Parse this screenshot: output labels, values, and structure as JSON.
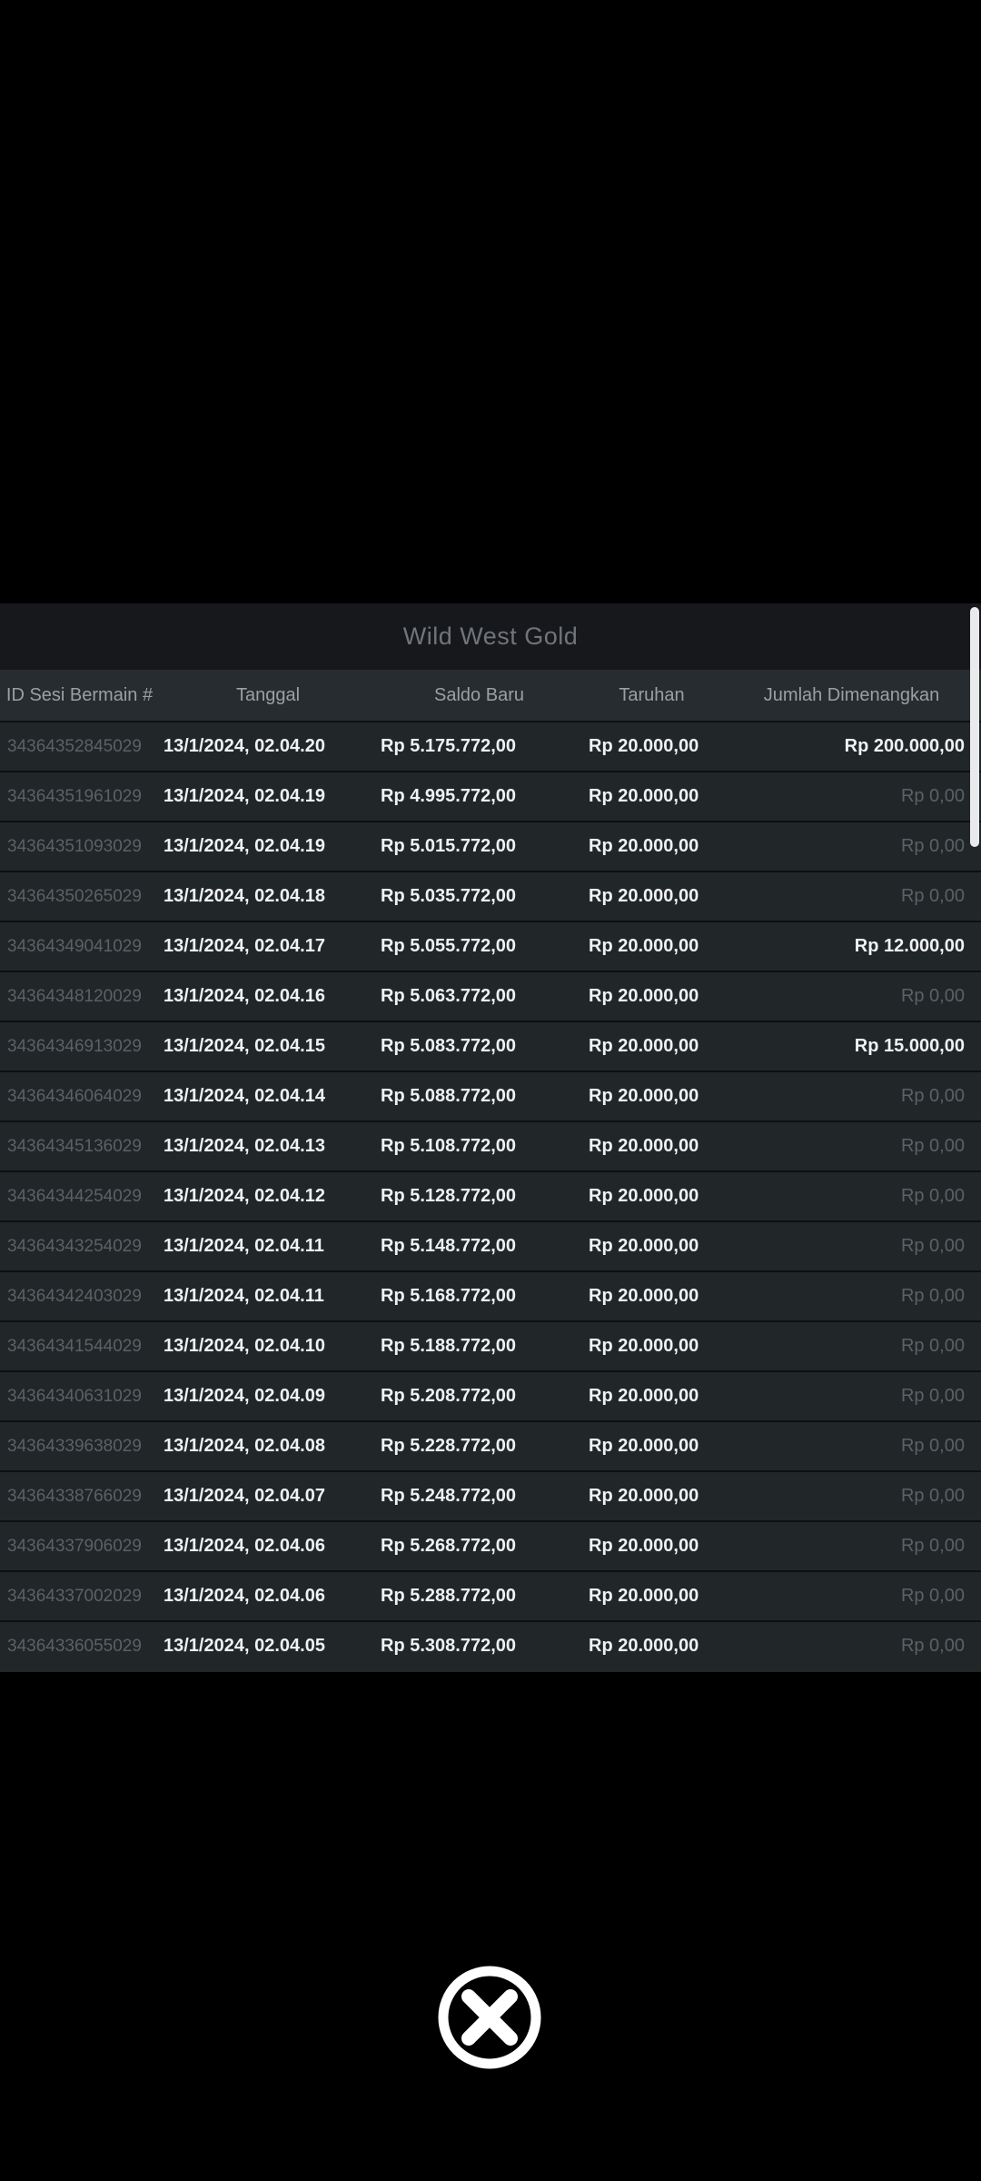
{
  "modal": {
    "title": "Wild West Gold",
    "columns": [
      "ID Sesi Bermain #",
      "Tanggal",
      "Saldo Baru",
      "Taruhan",
      "Jumlah Dimenangkan"
    ],
    "zero_win_display": "Rp 0,00",
    "rows": [
      {
        "id": "34364352845029",
        "date": "13/1/2024, 02.04.20",
        "balance": "Rp 5.175.772,00",
        "bet": "Rp 20.000,00",
        "win": "Rp 200.000,00"
      },
      {
        "id": "34364351961029",
        "date": "13/1/2024, 02.04.19",
        "balance": "Rp 4.995.772,00",
        "bet": "Rp 20.000,00",
        "win": "Rp 0,00"
      },
      {
        "id": "34364351093029",
        "date": "13/1/2024, 02.04.19",
        "balance": "Rp 5.015.772,00",
        "bet": "Rp 20.000,00",
        "win": "Rp 0,00"
      },
      {
        "id": "34364350265029",
        "date": "13/1/2024, 02.04.18",
        "balance": "Rp 5.035.772,00",
        "bet": "Rp 20.000,00",
        "win": "Rp 0,00"
      },
      {
        "id": "34364349041029",
        "date": "13/1/2024, 02.04.17",
        "balance": "Rp 5.055.772,00",
        "bet": "Rp 20.000,00",
        "win": "Rp 12.000,00"
      },
      {
        "id": "34364348120029",
        "date": "13/1/2024, 02.04.16",
        "balance": "Rp 5.063.772,00",
        "bet": "Rp 20.000,00",
        "win": "Rp 0,00"
      },
      {
        "id": "34364346913029",
        "date": "13/1/2024, 02.04.15",
        "balance": "Rp 5.083.772,00",
        "bet": "Rp 20.000,00",
        "win": "Rp 15.000,00"
      },
      {
        "id": "34364346064029",
        "date": "13/1/2024, 02.04.14",
        "balance": "Rp 5.088.772,00",
        "bet": "Rp 20.000,00",
        "win": "Rp 0,00"
      },
      {
        "id": "34364345136029",
        "date": "13/1/2024, 02.04.13",
        "balance": "Rp 5.108.772,00",
        "bet": "Rp 20.000,00",
        "win": "Rp 0,00"
      },
      {
        "id": "34364344254029",
        "date": "13/1/2024, 02.04.12",
        "balance": "Rp 5.128.772,00",
        "bet": "Rp 20.000,00",
        "win": "Rp 0,00"
      },
      {
        "id": "34364343254029",
        "date": "13/1/2024, 02.04.11",
        "balance": "Rp 5.148.772,00",
        "bet": "Rp 20.000,00",
        "win": "Rp 0,00"
      },
      {
        "id": "34364342403029",
        "date": "13/1/2024, 02.04.11",
        "balance": "Rp 5.168.772,00",
        "bet": "Rp 20.000,00",
        "win": "Rp 0,00"
      },
      {
        "id": "34364341544029",
        "date": "13/1/2024, 02.04.10",
        "balance": "Rp 5.188.772,00",
        "bet": "Rp 20.000,00",
        "win": "Rp 0,00"
      },
      {
        "id": "34364340631029",
        "date": "13/1/2024, 02.04.09",
        "balance": "Rp 5.208.772,00",
        "bet": "Rp 20.000,00",
        "win": "Rp 0,00"
      },
      {
        "id": "34364339638029",
        "date": "13/1/2024, 02.04.08",
        "balance": "Rp 5.228.772,00",
        "bet": "Rp 20.000,00",
        "win": "Rp 0,00"
      },
      {
        "id": "34364338766029",
        "date": "13/1/2024, 02.04.07",
        "balance": "Rp 5.248.772,00",
        "bet": "Rp 20.000,00",
        "win": "Rp 0,00"
      },
      {
        "id": "34364337906029",
        "date": "13/1/2024, 02.04.06",
        "balance": "Rp 5.268.772,00",
        "bet": "Rp 20.000,00",
        "win": "Rp 0,00"
      },
      {
        "id": "34364337002029",
        "date": "13/1/2024, 02.04.06",
        "balance": "Rp 5.288.772,00",
        "bet": "Rp 20.000,00",
        "win": "Rp 0,00"
      },
      {
        "id": "34364336055029",
        "date": "13/1/2024, 02.04.05",
        "balance": "Rp 5.308.772,00",
        "bet": "Rp 20.000,00",
        "win": "Rp 0,00"
      }
    ]
  },
  "close_button": {
    "icon": "circled-x-icon"
  },
  "colors": {
    "page_background": "#000000",
    "panel_background": "#212629",
    "title_band_background": "#17181b",
    "header_background": "#262c2f",
    "row_separator": "#0d0f11",
    "text_bright": "#eff1f2",
    "text_dim": "#5c6165",
    "header_text": "#9aa0a4",
    "title_text": "#70757a",
    "scrollbar_thumb": "#e9eaeb"
  }
}
